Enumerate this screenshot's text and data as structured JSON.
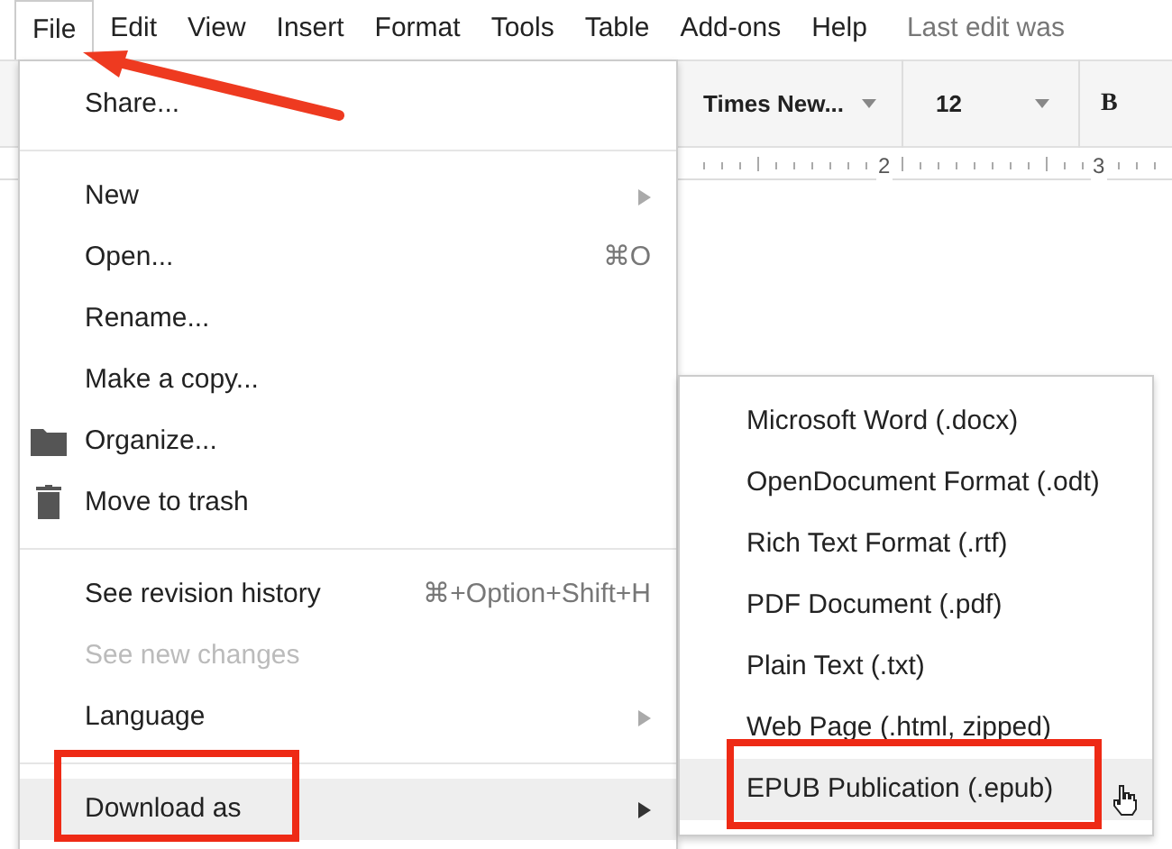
{
  "menubar": {
    "items": [
      {
        "label": "File",
        "selected": true
      },
      {
        "label": "Edit",
        "selected": false
      },
      {
        "label": "View",
        "selected": false
      },
      {
        "label": "Insert",
        "selected": false
      },
      {
        "label": "Format",
        "selected": false
      },
      {
        "label": "Tools",
        "selected": false
      },
      {
        "label": "Table",
        "selected": false
      },
      {
        "label": "Add-ons",
        "selected": false
      },
      {
        "label": "Help",
        "selected": false
      }
    ],
    "status": "Last edit was"
  },
  "toolbar": {
    "font": "Times New...",
    "size": "12",
    "bold": "B"
  },
  "ruler": [
    "2",
    "3"
  ],
  "file_menu": {
    "sections": [
      [
        {
          "label": "Share...",
          "kind": "plain",
          "submenu": false,
          "disabled": false,
          "selected": false
        }
      ],
      [
        {
          "label": "New",
          "kind": "plain",
          "submenu": true,
          "disabled": false,
          "selected": false
        },
        {
          "label": "Open...",
          "kind": "plain",
          "shortcut": "⌘O",
          "submenu": false,
          "disabled": false,
          "selected": false
        },
        {
          "label": "Rename...",
          "kind": "plain",
          "submenu": false,
          "disabled": false,
          "selected": false
        },
        {
          "label": "Make a copy...",
          "kind": "plain",
          "submenu": false,
          "disabled": false,
          "selected": false
        },
        {
          "label": "Organize...",
          "kind": "folder",
          "submenu": false,
          "disabled": false,
          "selected": false
        },
        {
          "label": "Move to trash",
          "kind": "trash",
          "submenu": false,
          "disabled": false,
          "selected": false
        }
      ],
      [
        {
          "label": "See revision history",
          "kind": "plain",
          "shortcut": "⌘+Option+Shift+H",
          "submenu": false,
          "disabled": false,
          "selected": false
        },
        {
          "label": "See new changes",
          "kind": "plain",
          "submenu": false,
          "disabled": true,
          "selected": false
        },
        {
          "label": "Language",
          "kind": "plain",
          "submenu": true,
          "disabled": false,
          "selected": false
        }
      ],
      [
        {
          "label": "Download as",
          "kind": "plain",
          "submenu": true,
          "disabled": false,
          "selected": true
        }
      ]
    ]
  },
  "download_menu": {
    "items": [
      {
        "label": "Microsoft Word (.docx)",
        "selected": false
      },
      {
        "label": "OpenDocument Format (.odt)",
        "selected": false
      },
      {
        "label": "Rich Text Format (.rtf)",
        "selected": false
      },
      {
        "label": "PDF Document (.pdf)",
        "selected": false
      },
      {
        "label": "Plain Text (.txt)",
        "selected": false
      },
      {
        "label": "Web Page (.html, zipped)",
        "selected": false
      },
      {
        "label": "EPUB Publication (.epub)",
        "selected": true
      }
    ]
  }
}
